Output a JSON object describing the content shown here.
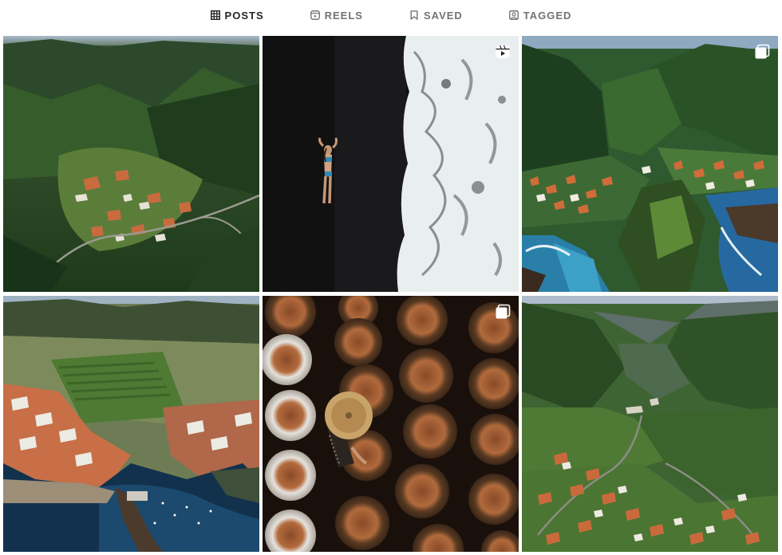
{
  "tabs": [
    {
      "label": "POSTS",
      "icon": "grid-icon",
      "active": true
    },
    {
      "label": "REELS",
      "icon": "reels-icon",
      "active": false
    },
    {
      "label": "SAVED",
      "icon": "bookmark-icon",
      "active": false
    },
    {
      "label": "TAGGED",
      "icon": "tag-portrait-icon",
      "active": false
    }
  ],
  "posts": [
    {
      "subject": "aerial mountain village",
      "badge": null
    },
    {
      "subject": "woman on black sand beach with waves",
      "badge": "reel-icon"
    },
    {
      "subject": "coastal cliff village",
      "badge": "carousel-icon"
    },
    {
      "subject": "harbour town aerial",
      "badge": null
    },
    {
      "subject": "clay pots with hat",
      "badge": "carousel-icon"
    },
    {
      "subject": "valley village",
      "badge": null
    }
  ],
  "colors": {
    "active_tab": "#262626",
    "inactive_tab": "#737373",
    "background": "#ffffff"
  }
}
